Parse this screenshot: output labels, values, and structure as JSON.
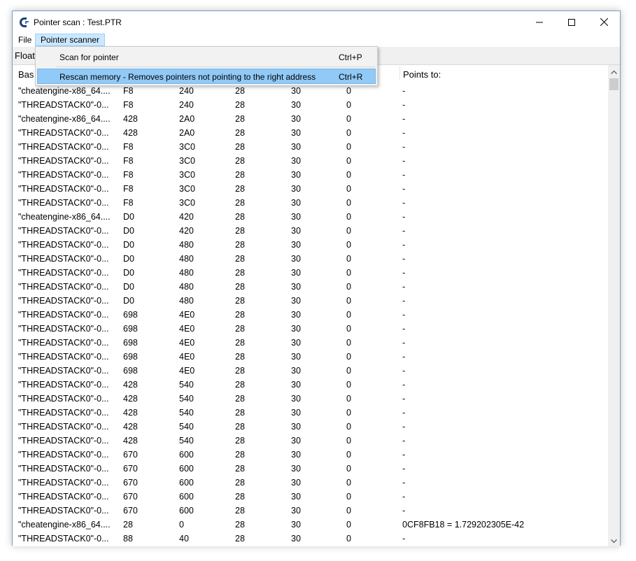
{
  "window": {
    "title": "Pointer scan : Test.PTR"
  },
  "menu": {
    "file": "File",
    "pointer_scanner": "Pointer scanner"
  },
  "toolbar": {
    "label": "Float"
  },
  "columns": {
    "base": "Bas",
    "points_to": "Points to:"
  },
  "dropdown": {
    "items": [
      {
        "label": "Scan for pointer",
        "shortcut": "Ctrl+P"
      },
      {
        "label": "Rescan memory - Removes pointers not pointing to the right address",
        "shortcut": "Ctrl+R"
      }
    ]
  },
  "rows": [
    [
      "\"cheatengine-x86_64....",
      "F8",
      "240",
      "28",
      "30",
      "0",
      "-"
    ],
    [
      "\"THREADSTACK0\"-0...",
      "F8",
      "240",
      "28",
      "30",
      "0",
      "-"
    ],
    [
      "\"cheatengine-x86_64....",
      "428",
      "2A0",
      "28",
      "30",
      "0",
      "-"
    ],
    [
      "\"THREADSTACK0\"-0...",
      "428",
      "2A0",
      "28",
      "30",
      "0",
      "-"
    ],
    [
      "\"THREADSTACK0\"-0...",
      "F8",
      "3C0",
      "28",
      "30",
      "0",
      "-"
    ],
    [
      "\"THREADSTACK0\"-0...",
      "F8",
      "3C0",
      "28",
      "30",
      "0",
      "-"
    ],
    [
      "\"THREADSTACK0\"-0...",
      "F8",
      "3C0",
      "28",
      "30",
      "0",
      "-"
    ],
    [
      "\"THREADSTACK0\"-0...",
      "F8",
      "3C0",
      "28",
      "30",
      "0",
      "-"
    ],
    [
      "\"THREADSTACK0\"-0...",
      "F8",
      "3C0",
      "28",
      "30",
      "0",
      "-"
    ],
    [
      "\"cheatengine-x86_64....",
      "D0",
      "420",
      "28",
      "30",
      "0",
      "-"
    ],
    [
      "\"THREADSTACK0\"-0...",
      "D0",
      "420",
      "28",
      "30",
      "0",
      "-"
    ],
    [
      "\"THREADSTACK0\"-0...",
      "D0",
      "480",
      "28",
      "30",
      "0",
      "-"
    ],
    [
      "\"THREADSTACK0\"-0...",
      "D0",
      "480",
      "28",
      "30",
      "0",
      "-"
    ],
    [
      "\"THREADSTACK0\"-0...",
      "D0",
      "480",
      "28",
      "30",
      "0",
      "-"
    ],
    [
      "\"THREADSTACK0\"-0...",
      "D0",
      "480",
      "28",
      "30",
      "0",
      "-"
    ],
    [
      "\"THREADSTACK0\"-0...",
      "D0",
      "480",
      "28",
      "30",
      "0",
      "-"
    ],
    [
      "\"THREADSTACK0\"-0...",
      "698",
      "4E0",
      "28",
      "30",
      "0",
      "-"
    ],
    [
      "\"THREADSTACK0\"-0...",
      "698",
      "4E0",
      "28",
      "30",
      "0",
      "-"
    ],
    [
      "\"THREADSTACK0\"-0...",
      "698",
      "4E0",
      "28",
      "30",
      "0",
      "-"
    ],
    [
      "\"THREADSTACK0\"-0...",
      "698",
      "4E0",
      "28",
      "30",
      "0",
      "-"
    ],
    [
      "\"THREADSTACK0\"-0...",
      "698",
      "4E0",
      "28",
      "30",
      "0",
      "-"
    ],
    [
      "\"THREADSTACK0\"-0...",
      "428",
      "540",
      "28",
      "30",
      "0",
      "-"
    ],
    [
      "\"THREADSTACK0\"-0...",
      "428",
      "540",
      "28",
      "30",
      "0",
      "-"
    ],
    [
      "\"THREADSTACK0\"-0...",
      "428",
      "540",
      "28",
      "30",
      "0",
      "-"
    ],
    [
      "\"THREADSTACK0\"-0...",
      "428",
      "540",
      "28",
      "30",
      "0",
      "-"
    ],
    [
      "\"THREADSTACK0\"-0...",
      "428",
      "540",
      "28",
      "30",
      "0",
      "-"
    ],
    [
      "\"THREADSTACK0\"-0...",
      "670",
      "600",
      "28",
      "30",
      "0",
      "-"
    ],
    [
      "\"THREADSTACK0\"-0...",
      "670",
      "600",
      "28",
      "30",
      "0",
      "-"
    ],
    [
      "\"THREADSTACK0\"-0...",
      "670",
      "600",
      "28",
      "30",
      "0",
      "-"
    ],
    [
      "\"THREADSTACK0\"-0...",
      "670",
      "600",
      "28",
      "30",
      "0",
      "-"
    ],
    [
      "\"THREADSTACK0\"-0...",
      "670",
      "600",
      "28",
      "30",
      "0",
      "-"
    ],
    [
      "\"cheatengine-x86_64....",
      "28",
      "0",
      "28",
      "30",
      "0",
      "0CF8FB18 = 1.729202305E-42"
    ],
    [
      "\"THREADSTACK0\"-0...",
      "88",
      "40",
      "28",
      "30",
      "0",
      "-"
    ]
  ],
  "icons": {
    "app": "cheat-engine-icon",
    "minimize": "minimize-icon",
    "maximize": "maximize-icon",
    "close": "close-icon",
    "scroll_up": "chevron-up-icon",
    "scroll_down": "chevron-down-icon"
  },
  "colors": {
    "menu_highlight": "#cce8ff",
    "dropdown_highlight": "#91c9f7",
    "window_border": "#7a9cc8"
  }
}
